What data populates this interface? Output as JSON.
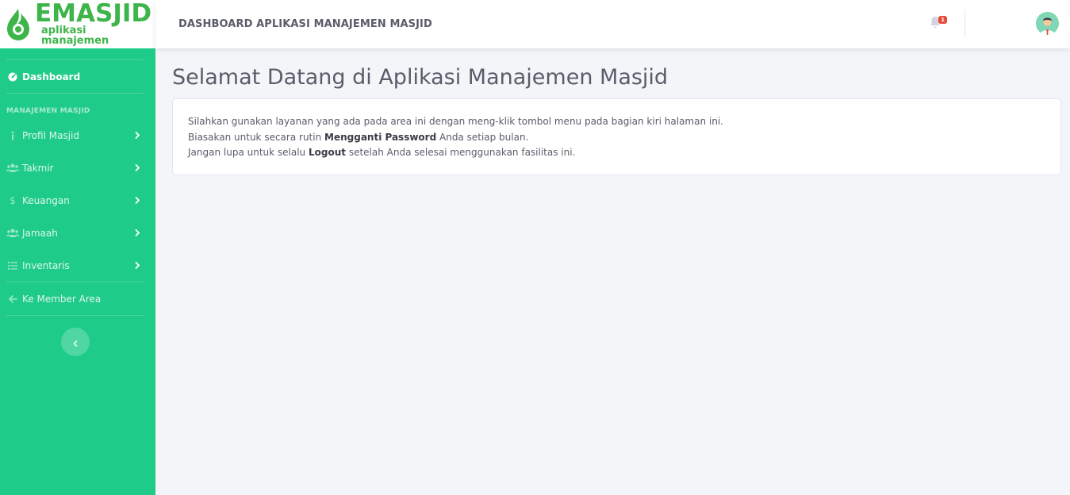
{
  "brand": {
    "name": "EMASJID",
    "subtitle": "aplikasi manajemen",
    "color": "#3eb54a"
  },
  "topbar": {
    "title": "DASHBOARD APLIKASI MANAJEMEN MASJID",
    "notification_count": "1",
    "user_name": "",
    "icons": [
      "bell-icon",
      "avatar"
    ]
  },
  "sidebar": {
    "color": "#1ecb88",
    "dashboard": {
      "label": "Dashboard",
      "icon": "gauge-icon"
    },
    "heading": "MANAJEMEN MASJID",
    "items": [
      {
        "label": "Profil Masjid",
        "icon": "info-icon"
      },
      {
        "label": "Takmir",
        "icon": "users-icon"
      },
      {
        "label": "Keuangan",
        "icon": "dollar-icon"
      },
      {
        "label": "Jamaah",
        "icon": "users-icon"
      },
      {
        "label": "Inventaris",
        "icon": "list-icon"
      }
    ],
    "member_area": {
      "label": "Ke Member Area",
      "icon": "arrow-left-icon"
    }
  },
  "main": {
    "page_title": "Selamat Datang di Aplikasi Manajemen Masjid",
    "line1": "Silahkan gunakan layanan yang ada pada area ini dengan meng-klik tombol menu pada bagian kiri halaman ini.",
    "line2_before": "Biasakan untuk secara rutin ",
    "line2_bold": "Mengganti Password",
    "line2_after": " Anda setiap bulan.",
    "line3_before": "Jangan lupa untuk selalu ",
    "line3_bold": "Logout",
    "line3_after": " setelah Anda selesai menggunakan fasilitas ini."
  }
}
